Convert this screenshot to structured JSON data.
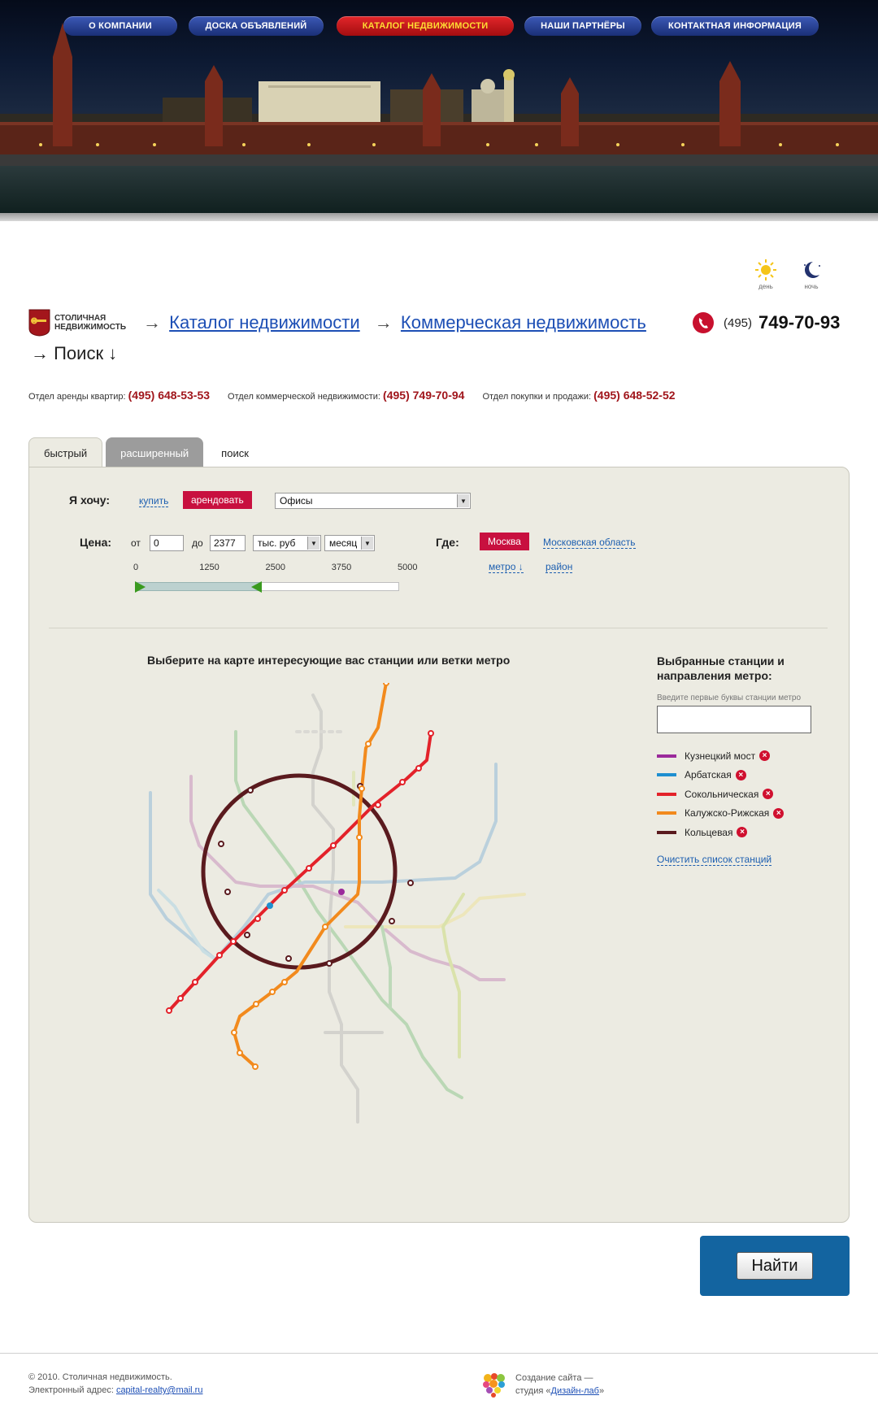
{
  "nav": [
    {
      "label": "О КОМПАНИИ",
      "active": false
    },
    {
      "label": "ДОСКА ОБЪЯВЛЕНИЙ",
      "active": false
    },
    {
      "label": "КАТАЛОГ НЕДВИЖИМОСТИ",
      "active": true
    },
    {
      "label": "НАШИ ПАРТНЁРЫ",
      "active": false
    },
    {
      "label": "КОНТАКТНАЯ ИНФОРМАЦИЯ",
      "active": false
    }
  ],
  "daynight": {
    "day": "день",
    "night": "ночь"
  },
  "logo": {
    "text": "СТОЛИЧНАЯ НЕДВИЖИМОСТЬ"
  },
  "breadcrumb": {
    "arrow": "→",
    "catalog": "Каталог недвижимости",
    "commercial": "Коммерческая недвижимость",
    "current": "→ Поиск ↓"
  },
  "phone": {
    "code": "(495)",
    "number": "749-70-93"
  },
  "departments": [
    {
      "label": "Отдел аренды квартир:",
      "phone": "(495) 648-53-53"
    },
    {
      "label": "Отдел коммерческой недвижимости:",
      "phone": "(495) 749-70-94"
    },
    {
      "label": "Отдел покупки и продажи:",
      "phone": "(495) 648-52-52"
    }
  ],
  "tabs": [
    {
      "label": "быстрый"
    },
    {
      "label": "расширенный"
    },
    {
      "label": "поиск"
    }
  ],
  "form": {
    "want_label": "Я хочу:",
    "buy": "купить",
    "rent": "арендовать",
    "type_value": "Офисы",
    "price_label": "Цена:",
    "from": "от",
    "from_value": "0",
    "to": "до",
    "to_value": "2377",
    "currency": "тыс. руб",
    "period": "месяц",
    "where_label": "Где:",
    "moscow": "Москва",
    "region": "Московская область",
    "metro": "метро ↓",
    "district": "район",
    "slider_ticks": [
      "0",
      "1250",
      "2500",
      "3750",
      "5000"
    ],
    "slider_value": [
      0,
      2377
    ],
    "slider_max": 5000
  },
  "map": {
    "title": "Выберите на карте интересующие вас станции или ветки метро"
  },
  "selected": {
    "title": "Выбранные станции и направления метро:",
    "hint": "Введите первые буквы станции метро",
    "items": [
      {
        "name": "Кузнецкий мост",
        "color": "#9b2a9b"
      },
      {
        "name": "Арбатская",
        "color": "#1e8fd0"
      },
      {
        "name": "Сокольническая",
        "color": "#e3222a"
      },
      {
        "name": "Калужско-Рижская",
        "color": "#f28a1d"
      },
      {
        "name": "Кольцевая",
        "color": "#5a1a1e"
      }
    ],
    "clear": "Очистить список станций"
  },
  "find_button": "Найти",
  "footer": {
    "copyright": "© 2010. Столичная недвижимость.",
    "email_label": "Электронный адрес:",
    "email": "capital-realty@mail.ru",
    "made_by_1": "Создание сайта —",
    "made_by_2": "студия «",
    "studio": "Дизайн-лаб",
    "made_by_3": "»"
  }
}
